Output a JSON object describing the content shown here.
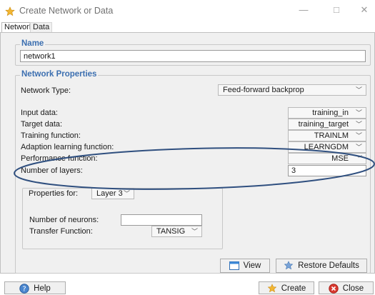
{
  "window": {
    "title": "Create Network or Data",
    "minimize": "—",
    "maximize": "□",
    "close": "✕"
  },
  "tabs": [
    {
      "label": "Network",
      "active": true
    },
    {
      "label": "Data",
      "active": false
    }
  ],
  "name_section": {
    "title": "Name",
    "value": "network1"
  },
  "properties": {
    "title": "Network Properties",
    "network_type": {
      "label": "Network Type:",
      "value": "Feed-forward backprop"
    },
    "fields": [
      {
        "label": "Input data:",
        "value": "training_in"
      },
      {
        "label": "Target data:",
        "value": "training_target"
      },
      {
        "label": "Training function:",
        "value": "TRAINLM"
      },
      {
        "label": "Adaption learning function:",
        "value": "LEARNGDM"
      },
      {
        "label": "Performance function:",
        "value": "MSE"
      }
    ],
    "layers": {
      "label": "Number of layers:",
      "value": "3"
    }
  },
  "layer_props": {
    "title": "Properties for:",
    "selected_layer": "Layer 3",
    "neurons_label": "Number of neurons:",
    "neurons_value": "",
    "transfer_label": "Transfer Function:",
    "transfer_value": "TANSIG"
  },
  "buttons": {
    "view": "View",
    "restore": "Restore Defaults",
    "help": "Help",
    "create": "Create",
    "close": "Close"
  },
  "colors": {
    "accent": "#3c6fb0",
    "annotation": "#2f4f7f"
  },
  "icons": {
    "title": "star-icon",
    "view": "window-icon",
    "restore": "star-icon",
    "help": "help-icon",
    "create": "star-icon",
    "close": "close-circle-icon"
  }
}
